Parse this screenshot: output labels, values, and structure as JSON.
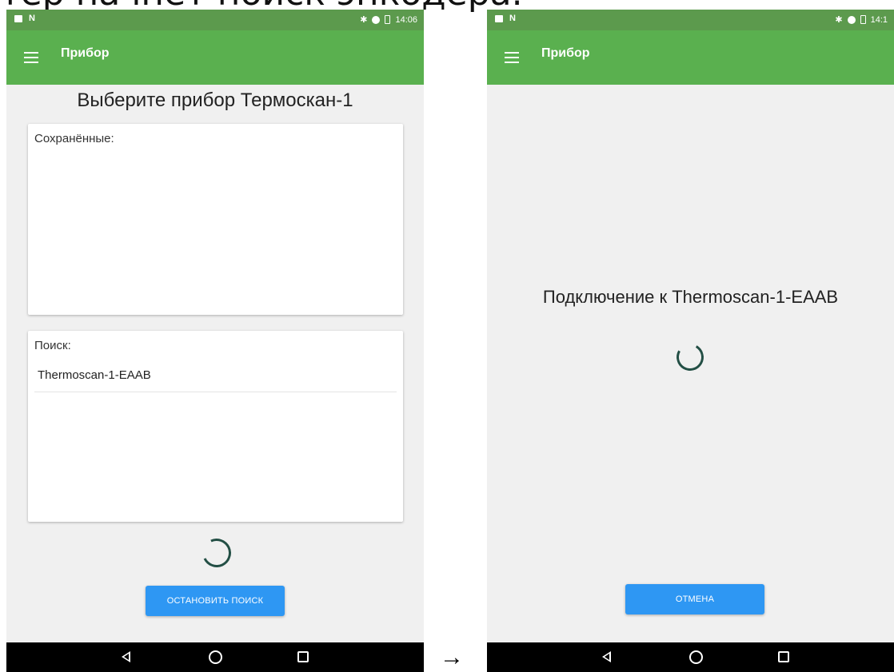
{
  "caption": "тер начнет поиск энкодера.",
  "arrow": "→",
  "left_screen": {
    "status_bar": {
      "time": "14:06"
    },
    "app_bar": {
      "title": "Прибор"
    },
    "page_title": "Выберите прибор Термоскан-1",
    "saved_card": {
      "label": "Сохранённые:"
    },
    "search_card": {
      "label": "Поиск:",
      "devices": [
        "Thermoscan-1-EAAB"
      ]
    },
    "stop_button_label": "ОСТАНОВИТЬ ПОИСК"
  },
  "right_screen": {
    "status_bar": {
      "time": "14:1"
    },
    "app_bar": {
      "title": "Прибор"
    },
    "connecting_text": "Подключение к Thermoscan-1-EAAB",
    "cancel_button_label": "ОТМЕНА"
  },
  "colors": {
    "status_bar": "#5c9a4d",
    "app_bar": "#5ab04f",
    "button": "#2e97f3",
    "spinner": "#234f45",
    "background": "#f0f0f0",
    "nav_bar": "#000000"
  },
  "icons": [
    "menu-icon",
    "bluetooth-icon",
    "battery-icon",
    "back-icon",
    "home-icon",
    "recent-apps-icon",
    "spinner-icon"
  ]
}
